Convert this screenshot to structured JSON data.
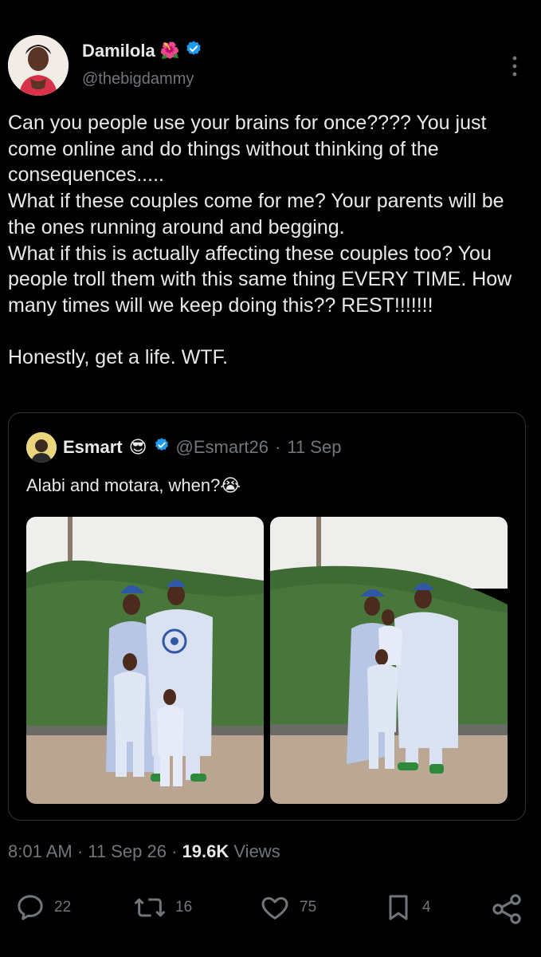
{
  "author": {
    "name": "Damilola",
    "name_emoji": "🌺",
    "handle": "@thebigdammy"
  },
  "tweet": {
    "text": "Can you people use your brains for once???? You just come online and do things without thinking of the consequences.....\nWhat if these couples come for me? Your parents will be the ones running around and begging.\nWhat if this is actually affecting these couples too? You people troll them with this same thing EVERY TIME. How many times will we keep doing this?? REST!!!!!!!\n\nHonestly, get a life. WTF."
  },
  "quoted": {
    "name": "Esmart",
    "name_emoji": "😎",
    "handle": "@Esmart26",
    "separator": "·",
    "date": "11 Sep",
    "text": "Alabi and motara, when?",
    "text_emoji": "😭"
  },
  "meta": {
    "time": "8:01 AM",
    "dot1": "·",
    "date": "11 Sep 26",
    "dot2": "·",
    "views_count": "19.6K",
    "views_label": "Views"
  },
  "actions": {
    "replies": "22",
    "reposts": "16",
    "likes": "75",
    "bookmarks": "4"
  },
  "colors": {
    "background": "#000000",
    "text": "#e7e9ea",
    "secondary": "#71767b",
    "verified": "#1d9bf0",
    "border": "#2f3336"
  },
  "icons": [
    "verified-badge-icon",
    "more-vertical-icon",
    "reply-icon",
    "repost-icon",
    "like-icon",
    "bookmark-icon",
    "share-icon"
  ]
}
